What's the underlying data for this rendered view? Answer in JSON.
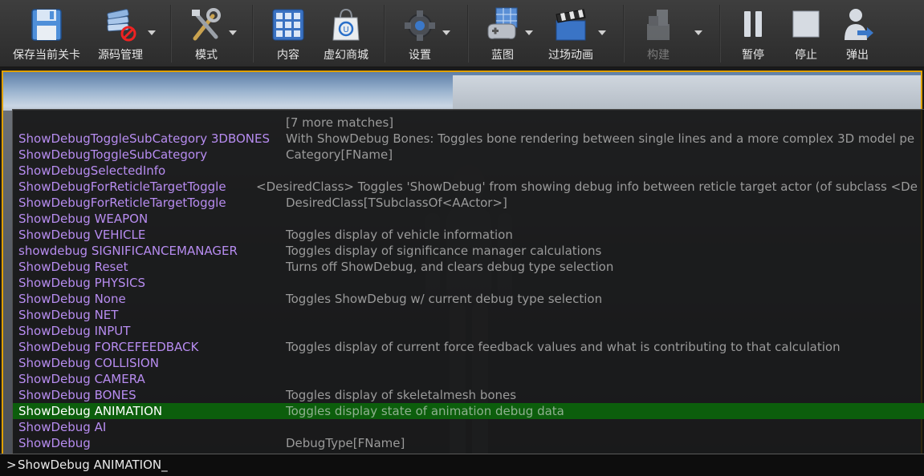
{
  "toolbar": {
    "items": [
      {
        "label": "保存当前关卡",
        "icon": "save-disk-icon"
      },
      {
        "label": "源码管理",
        "icon": "source-control-icon"
      },
      {
        "label": "模式",
        "icon": "modes-tools-icon"
      },
      {
        "label": "内容",
        "icon": "content-grid-icon"
      },
      {
        "label": "虚幻商城",
        "icon": "marketplace-bag-icon"
      },
      {
        "label": "设置",
        "icon": "settings-gear-icon"
      },
      {
        "label": "蓝图",
        "icon": "blueprint-gamepad-icon"
      },
      {
        "label": "过场动画",
        "icon": "cinematics-clapper-icon"
      },
      {
        "label": "构建",
        "icon": "build-cubes-icon"
      },
      {
        "label": "暂停",
        "icon": "pause-icon"
      },
      {
        "label": "停止",
        "icon": "stop-icon"
      },
      {
        "label": "弹出",
        "icon": "eject-icon"
      }
    ],
    "accent": "#e0a000"
  },
  "console": {
    "header": "[7 more matches]",
    "rows": [
      {
        "cmd": "ShowDebugToggleSubCategory 3DBONES",
        "desc": "With ShowDebug Bones: Toggles bone rendering between single lines and a more complex 3D model pe"
      },
      {
        "cmd": "ShowDebugToggleSubCategory",
        "desc": "Category[FName]"
      },
      {
        "cmd": "ShowDebugSelectedInfo",
        "desc": ""
      },
      {
        "cmd": "ShowDebugForReticleTargetToggle",
        "desc": "<DesiredClass> Toggles 'ShowDebug' from showing debug info between reticle target actor (of subclass <De"
      },
      {
        "cmd": "ShowDebugForReticleTargetToggle",
        "desc": "DesiredClass[TSubclassOf<AActor>]"
      },
      {
        "cmd": "ShowDebug WEAPON",
        "desc": ""
      },
      {
        "cmd": "ShowDebug VEHICLE",
        "desc": "Toggles display of vehicle information"
      },
      {
        "cmd": "showdebug SIGNIFICANCEMANAGER",
        "desc": "Toggles display of significance manager calculations"
      },
      {
        "cmd": "ShowDebug Reset",
        "desc": "Turns off ShowDebug, and clears debug type selection"
      },
      {
        "cmd": "ShowDebug PHYSICS",
        "desc": ""
      },
      {
        "cmd": "ShowDebug None",
        "desc": "Toggles ShowDebug w/ current debug type selection"
      },
      {
        "cmd": "ShowDebug NET",
        "desc": ""
      },
      {
        "cmd": "ShowDebug INPUT",
        "desc": ""
      },
      {
        "cmd": "ShowDebug FORCEFEEDBACK",
        "desc": "Toggles display of current force feedback values and what is contributing to that calculation"
      },
      {
        "cmd": "ShowDebug COLLISION",
        "desc": ""
      },
      {
        "cmd": "ShowDebug CAMERA",
        "desc": ""
      },
      {
        "cmd": "ShowDebug BONES",
        "desc": "Toggles display of skeletalmesh bones"
      },
      {
        "cmd": "ShowDebug ANIMATION",
        "desc": "Toggles display state of animation debug data"
      },
      {
        "cmd": "ShowDebug AI",
        "desc": ""
      },
      {
        "cmd": "ShowDebug",
        "desc": "DebugType[FName]"
      }
    ],
    "selected_index": 17,
    "colors": {
      "command": "#b78cf0",
      "description": "#9a9a9a",
      "selected_bg": "#0c5e0c"
    }
  },
  "input": {
    "prompt": ">",
    "value": "ShowDebug ANIMATION_"
  }
}
